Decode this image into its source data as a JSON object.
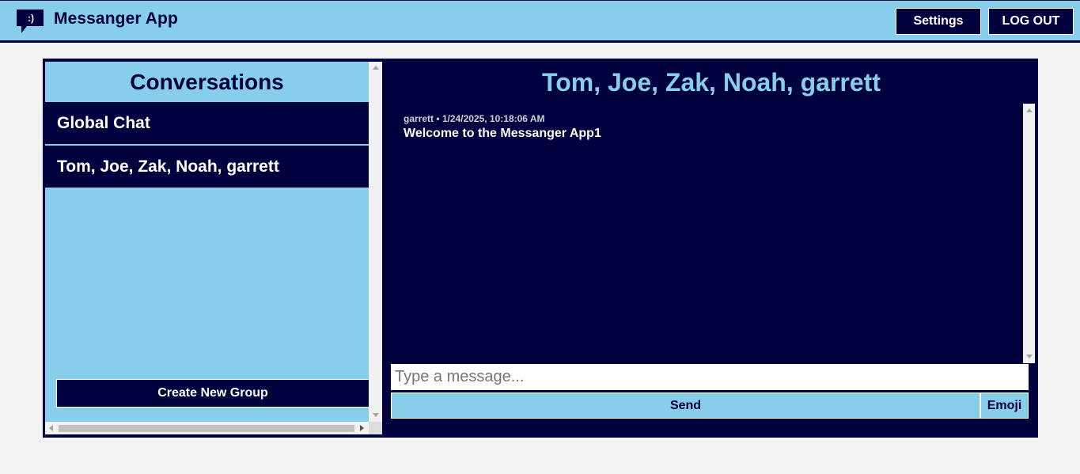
{
  "header": {
    "app_title": "Messanger App",
    "logo_icon": "chat-bubble-smile-icon",
    "settings_label": "Settings",
    "logout_label": "LOG OUT"
  },
  "sidebar": {
    "title": "Conversations",
    "conversations": [
      {
        "label": "Global Chat"
      },
      {
        "label": "Tom, Joe, Zak, Noah, garrett"
      }
    ],
    "create_group_label": "Create New Group"
  },
  "chat": {
    "title": "Tom, Joe, Zak, Noah, garrett",
    "messages": [
      {
        "meta": "garrett • 1/24/2025, 10:18:06 AM",
        "text": "Welcome to the Messanger App1"
      }
    ],
    "input_placeholder": "Type a message...",
    "input_value": "",
    "send_label": "Send",
    "emoji_label": "Emoji"
  },
  "colors": {
    "navy": "#00003f",
    "sky": "#87ceeb",
    "page_bg": "#f3f3f3"
  }
}
